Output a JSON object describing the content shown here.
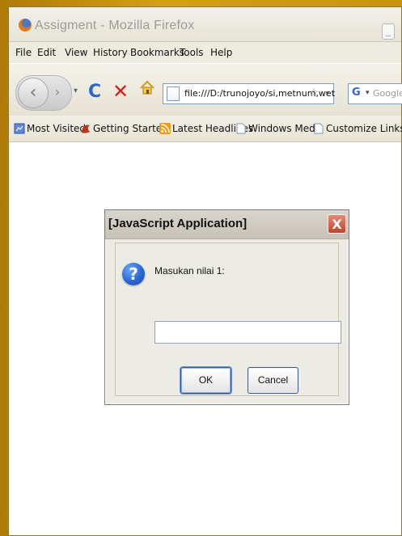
{
  "window": {
    "title": "Assigment - Mozilla Firefox"
  },
  "menu": {
    "items": [
      "File",
      "Edit",
      "View",
      "History",
      "Bookmarks",
      "Tools",
      "Help"
    ]
  },
  "nav": {
    "url": "file:///D:/trunojoyo/si,metnum,wet",
    "search_placeholder": "Google"
  },
  "bookmarks": {
    "items": [
      "Most Visited",
      "Getting Started",
      "Latest Headlines",
      "Windows Media",
      "Customize Links"
    ]
  },
  "dialog": {
    "title": "[JavaScript Application]",
    "message": "Masukan nilai 1:",
    "ok": "OK",
    "cancel": "Cancel",
    "close": "X",
    "input_value": ""
  },
  "glyphs": {
    "back": "‹",
    "forward": "›",
    "dropdown": "▾",
    "reload": "C",
    "stop": "✕",
    "star": "☆",
    "minimize": "_",
    "question": "?"
  },
  "colors": {
    "accent_blue": "#2f67c9",
    "stop_red": "#d51d17",
    "dialog_bg": "#eceae2"
  }
}
